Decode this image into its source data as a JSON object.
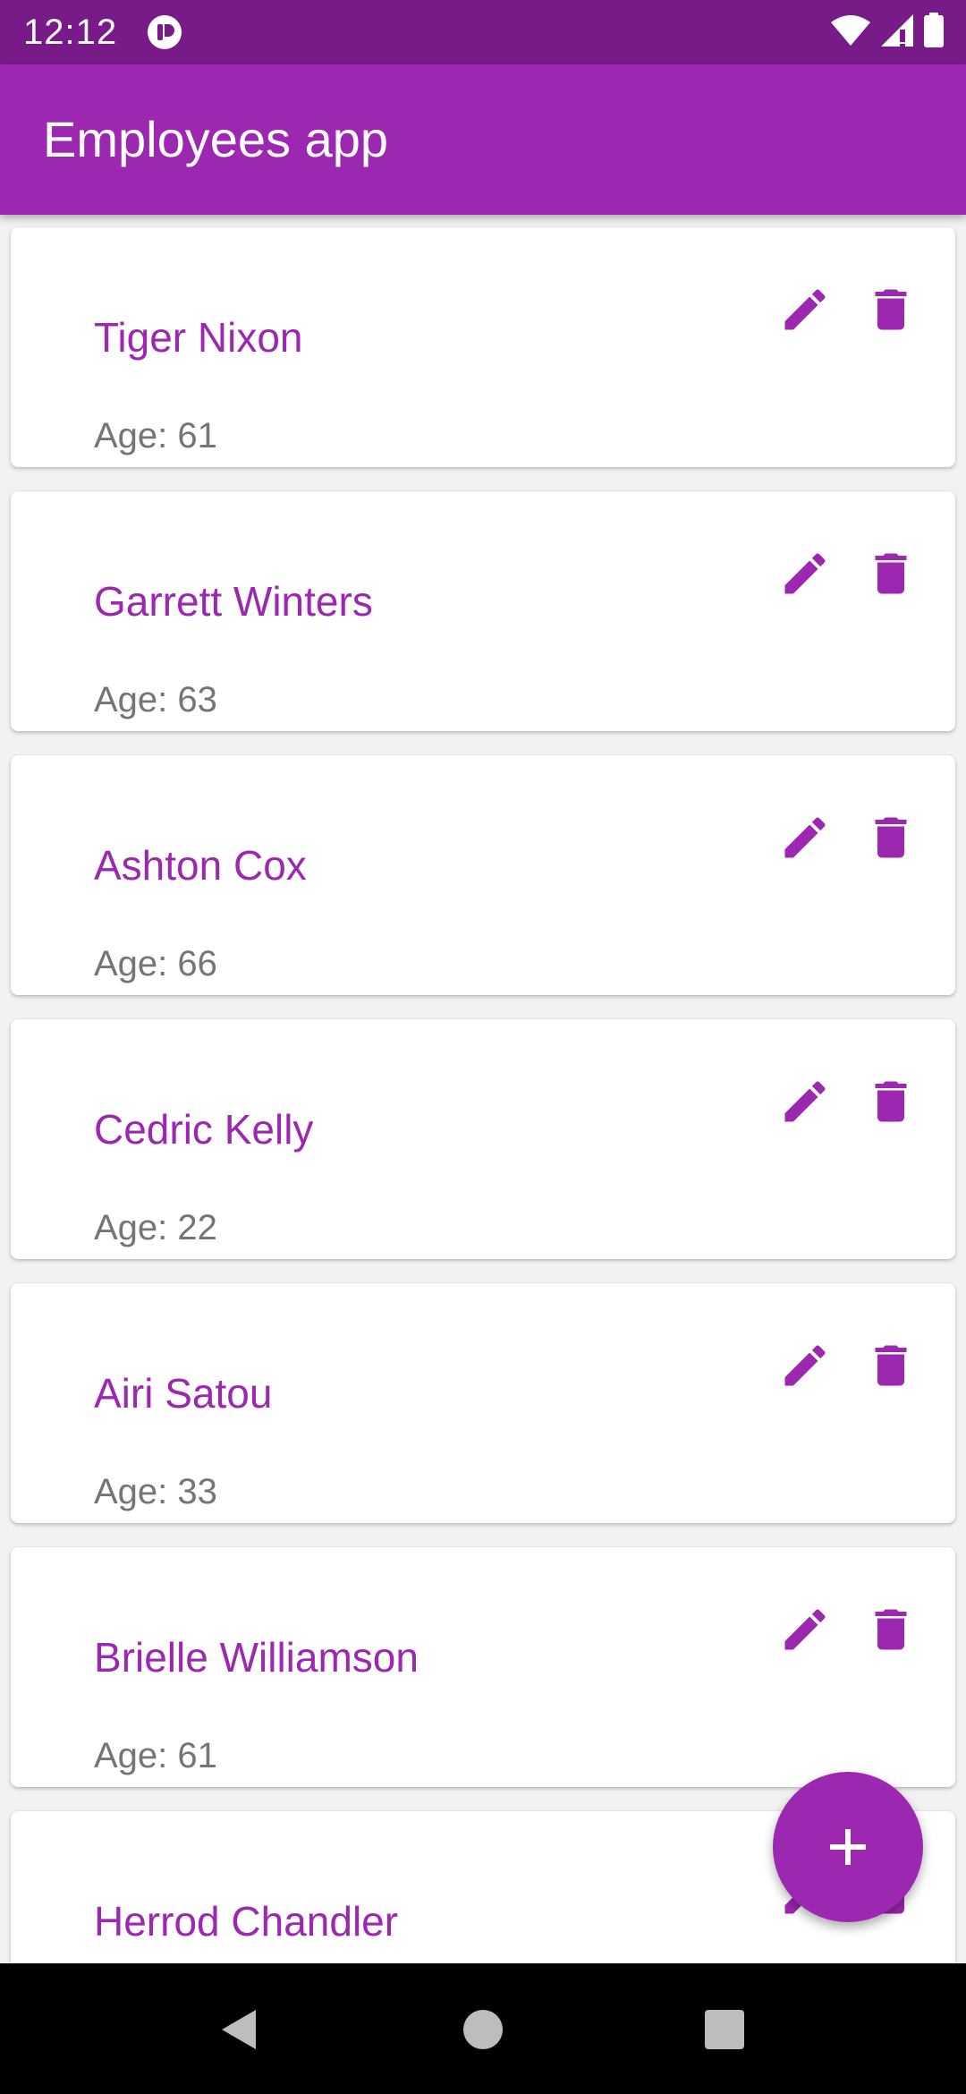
{
  "status_bar": {
    "time": "12:12",
    "icons": [
      "app-notification-icon",
      "wifi-icon",
      "signal-icon",
      "battery-icon"
    ]
  },
  "app_bar": {
    "title": "Employees app"
  },
  "employees": [
    {
      "name": "Tiger Nixon",
      "age_label": "Age: 61"
    },
    {
      "name": "Garrett Winters",
      "age_label": "Age: 63"
    },
    {
      "name": "Ashton Cox",
      "age_label": "Age: 66"
    },
    {
      "name": "Cedric Kelly",
      "age_label": "Age: 22"
    },
    {
      "name": "Airi Satou",
      "age_label": "Age: 33"
    },
    {
      "name": "Brielle Williamson",
      "age_label": "Age: 61"
    },
    {
      "name": "Herrod Chandler",
      "age_label": ""
    }
  ],
  "card_actions": {
    "edit_icon": "pencil-icon",
    "delete_icon": "trash-icon"
  },
  "fab": {
    "icon": "plus-icon"
  },
  "nav_bar": {
    "icons": [
      "back-icon",
      "home-icon",
      "recents-icon"
    ]
  },
  "colors": {
    "status_bar": "#781a87",
    "primary": "#9c27b0",
    "age_text": "#757575",
    "background": "#f2f2f2",
    "card": "#ffffff",
    "nav_bar": "#000000"
  }
}
